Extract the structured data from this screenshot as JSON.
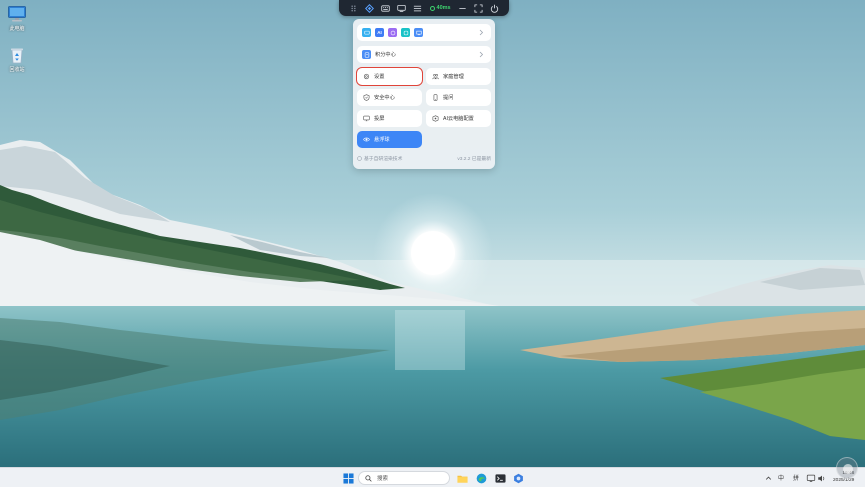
{
  "desktop": {
    "icons": [
      {
        "label": "此电脑",
        "icon": "computer-icon"
      },
      {
        "label": "回收站",
        "icon": "recycle-bin-icon"
      }
    ]
  },
  "remote_toolbar": {
    "latency": "40ms",
    "buttons": [
      "drag-handle-icon",
      "diamond-icon",
      "keyboard-icon",
      "display-icon",
      "menu-icon",
      "minimize-icon",
      "fullscreen-icon",
      "power-icon"
    ],
    "accent": "#3ed36f"
  },
  "panel": {
    "apps_row": {
      "chips": [
        "AI"
      ]
    },
    "points_row": {
      "label": "积分中心"
    },
    "buttons": {
      "settings": "设置",
      "family": "家庭管理",
      "security": "安全中心",
      "feedback": "提问",
      "cast": "投屏",
      "ai_config": "AI云电脑配置",
      "float_ball": "悬浮球"
    },
    "footer": {
      "left": "基于自研渲染技术",
      "right": "v3.2.2 已是最新"
    }
  },
  "taskbar": {
    "search_placeholder": "搜索",
    "tray": {
      "ime_lang": "中",
      "ime_mode": "拼"
    },
    "clock": {
      "time": "16:46",
      "date": "2025/1/29"
    }
  }
}
